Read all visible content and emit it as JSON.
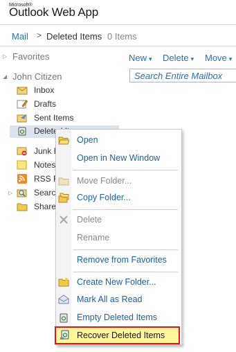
{
  "app": {
    "brand_small": "Microsoft®",
    "brand_name": "Outlook Web App"
  },
  "breadcrumb": {
    "root": "Mail",
    "separator": ">",
    "current": "Deleted Items",
    "count": "0 Items"
  },
  "nav": {
    "favorites_label": "Favorites",
    "mailbox_label": "John Citizen",
    "folders": [
      {
        "label": "Inbox",
        "icon": "inbox-icon"
      },
      {
        "label": "Drafts",
        "icon": "drafts-icon"
      },
      {
        "label": "Sent Items",
        "icon": "sent-items-icon"
      },
      {
        "label": "Deleted Items",
        "icon": "recycle-bin-icon"
      },
      {
        "label": "Junk E-mail",
        "icon": "junk-email-icon"
      },
      {
        "label": "Notes",
        "icon": "notes-icon"
      },
      {
        "label": "RSS Feeds",
        "icon": "rss-icon"
      },
      {
        "label": "Search Folders",
        "icon": "search-folder-icon"
      },
      {
        "label": "Shared",
        "icon": "folder-icon"
      }
    ]
  },
  "toolbar": {
    "new_label": "New",
    "delete_label": "Delete",
    "move_label": "Move",
    "caret": "▾"
  },
  "search": {
    "placeholder": "Search Entire Mailbox"
  },
  "context_menu": {
    "items": [
      {
        "label": "Open",
        "icon": "open-folder-icon",
        "disabled": false
      },
      {
        "label": "Open in New Window",
        "icon": "",
        "disabled": false
      },
      {
        "label": "Move Folder...",
        "icon": "move-folder-icon",
        "disabled": true
      },
      {
        "label": "Copy Folder...",
        "icon": "copy-folder-icon",
        "disabled": false
      },
      {
        "label": "Delete",
        "icon": "delete-x-icon",
        "disabled": true
      },
      {
        "label": "Rename",
        "icon": "",
        "disabled": true
      },
      {
        "label": "Remove from Favorites",
        "icon": "",
        "disabled": false
      },
      {
        "label": "Create New Folder...",
        "icon": "new-folder-icon",
        "disabled": false
      },
      {
        "label": "Mark All as Read",
        "icon": "mark-read-icon",
        "disabled": false
      },
      {
        "label": "Empty Deleted Items",
        "icon": "recycle-bin-icon",
        "disabled": false
      },
      {
        "label": "Recover Deleted Items",
        "icon": "recover-icon",
        "disabled": false
      }
    ]
  },
  "colors": {
    "link": "#2a6fb5",
    "highlight_fill": "#fff59a",
    "highlight_border": "#e0161a",
    "selected_row": "#dbe3ee"
  }
}
